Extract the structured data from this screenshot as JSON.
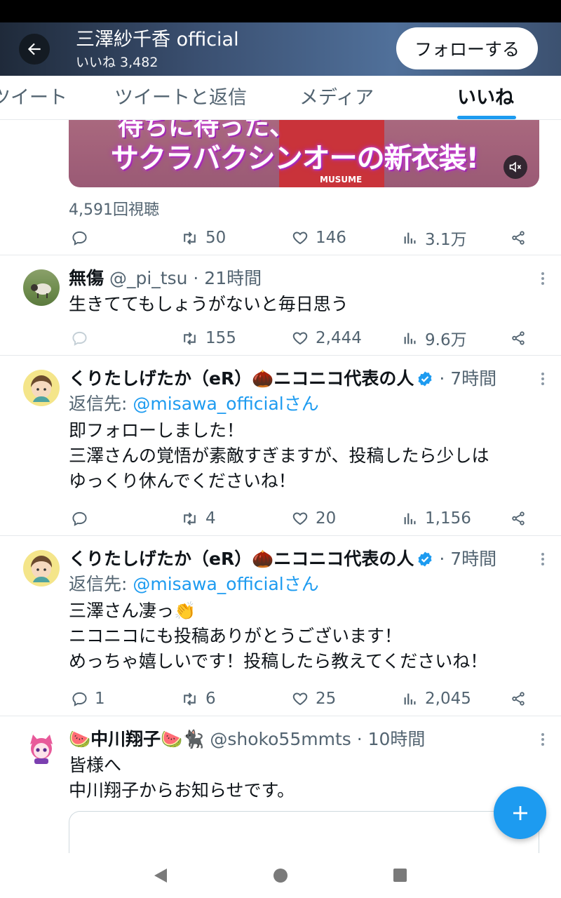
{
  "header": {
    "name": "三澤紗千香 official",
    "subtitle": "いいね 3,482",
    "follow_label": "フォローする"
  },
  "tabs": [
    {
      "label": "ツイート"
    },
    {
      "label": "ツイートと返信"
    },
    {
      "label": "メディア"
    },
    {
      "label": "いいね",
      "active": true
    }
  ],
  "video_post": {
    "banner_top": "待ちに待った、",
    "banner": "サクラバクシンオーの新衣装!",
    "jersey_text": "MUSUME",
    "views": "4,591回視聴",
    "replies": "",
    "retweets": "50",
    "likes": "146",
    "analytics": "3.1万"
  },
  "tweets": [
    {
      "name": "無傷",
      "meta": "@_pi_tsu · 21時間",
      "reply_prefix": "",
      "reply_handle": "",
      "reply_suffix": "",
      "text": "生きててもしょうがないと毎日思う",
      "replies": "",
      "retweets": "155",
      "likes": "2,444",
      "analytics": "9.6万"
    },
    {
      "name": "くりたしげたか（eR）",
      "name_emoji": "🌰",
      "name_suffix": "ニコニコ代表の人",
      "meta": "· 7時間",
      "reply_prefix": "返信先: ",
      "reply_handle": "@misawa_official",
      "reply_suffix": "さん",
      "text": "即フォローしました！\n三澤さんの覚悟が素敵すぎますが、投稿したら少しは\nゆっくり休んでくださいね！",
      "replies": "",
      "retweets": "4",
      "likes": "20",
      "analytics": "1,156"
    },
    {
      "name": "くりたしげたか（eR）",
      "name_emoji": "🌰",
      "name_suffix": "ニコニコ代表の人",
      "meta": "· 7時間",
      "reply_prefix": "返信先: ",
      "reply_handle": "@misawa_official",
      "reply_suffix": "さん",
      "text_line1": "三澤さん凄っ",
      "text_line1_emoji": "👏",
      "text": "ニコニコにも投稿ありがとうございます！\nめっちゃ嬉しいです！投稿したら教えてくださいね！",
      "replies": "1",
      "retweets": "6",
      "likes": "25",
      "analytics": "2,045"
    },
    {
      "name_prefix_emoji": "🍉",
      "name": "中川翔子",
      "name_emoji": "🍉🐈‍⬛",
      "meta": "@shoko55mmts · 10時間",
      "text": "皆様へ\n中川翔子からお知らせです。"
    }
  ],
  "colors": {
    "accent": "#1d9bf0",
    "text": "#0f1419",
    "muted": "#536471",
    "divider": "#e6e9ec"
  },
  "icons": [
    "back-arrow-icon",
    "mute-icon",
    "reply-icon",
    "retweet-icon",
    "like-icon",
    "analytics-icon",
    "share-icon",
    "more-icon",
    "verified-icon",
    "compose-plus-icon"
  ]
}
